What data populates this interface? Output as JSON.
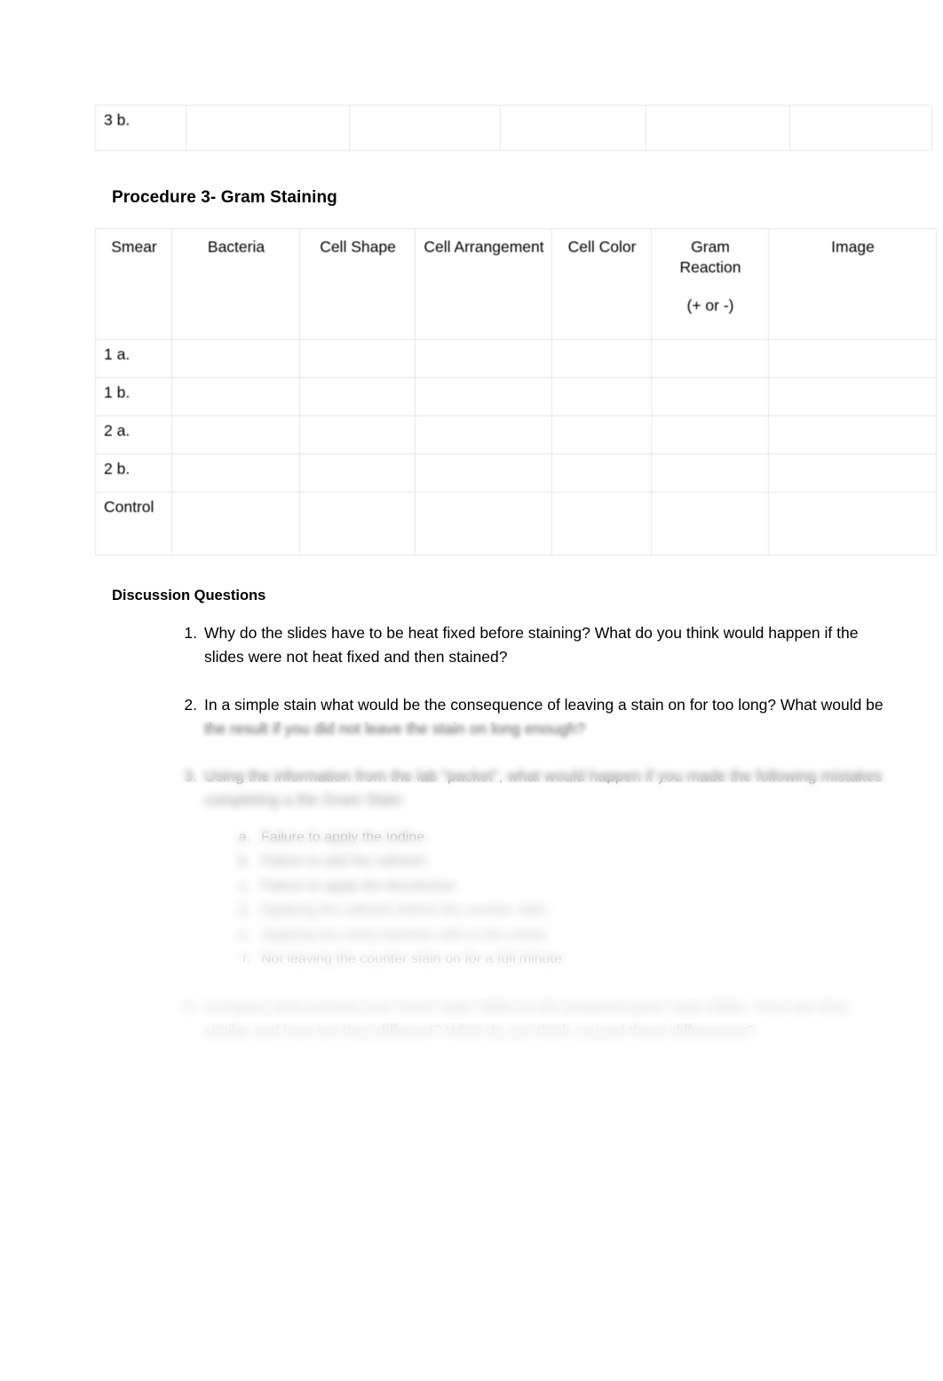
{
  "document": {
    "top_table": {
      "rows": [
        {
          "label": "3 b.",
          "cells": [
            "",
            "",
            "",
            "",
            ""
          ]
        }
      ]
    },
    "procedure_heading": "Procedure 3- Gram Staining",
    "gram_table": {
      "headers": [
        "Smear",
        "Bacteria",
        "Cell Shape",
        "Cell Arrangement",
        "Cell Color",
        "Gram Reaction",
        "Image"
      ],
      "header_gram_reaction_note": "(+ or -)",
      "rows": [
        {
          "label": "1 a.",
          "cells": [
            "",
            "",
            "",
            "",
            "",
            ""
          ]
        },
        {
          "label": "1 b.",
          "cells": [
            "",
            "",
            "",
            "",
            "",
            ""
          ]
        },
        {
          "label": "2 a.",
          "cells": [
            "",
            "",
            "",
            "",
            "",
            ""
          ]
        },
        {
          "label": "2 b.",
          "cells": [
            "",
            "",
            "",
            "",
            "",
            ""
          ]
        },
        {
          "label": "Control",
          "cells": [
            "",
            "",
            "",
            "",
            "",
            ""
          ]
        }
      ]
    },
    "discussion": {
      "heading": "Discussion Questions",
      "questions": [
        {
          "number": "1.",
          "text": "Why do the slides have to be heat fixed before staining? What do you think would happen if the slides were not heat fixed and then stained?"
        },
        {
          "number": "2.",
          "text": "In a simple stain what would be the consequence of leaving a stain on for too long? What would be the result if you did not leave the stain on long enough?"
        },
        {
          "number": "3.",
          "text": "Using the information from the lab \"packet\", what would happen if you made the following mistakes completing a the Gram Stain:",
          "subitems": [
            {
              "number": "a.",
              "text": "Failure to apply the Iodine"
            },
            {
              "number": "b.",
              "text": "Failure to add the safranin"
            },
            {
              "number": "c.",
              "text": "Failure to apply the decolorizer"
            },
            {
              "number": "d.",
              "text": "Applying the safranin before the counter stain"
            },
            {
              "number": "e.",
              "text": "Applying too many bacteria cells to the smear"
            },
            {
              "number": "f.",
              "text": "Not leaving the counter stain on for a full minute"
            }
          ]
        },
        {
          "number": "4.",
          "text": "Compare and contrast your Gram stain slides to the prepared gram stain slides. How are they similar and how are they different? What do you think caused these differences?"
        }
      ]
    }
  }
}
